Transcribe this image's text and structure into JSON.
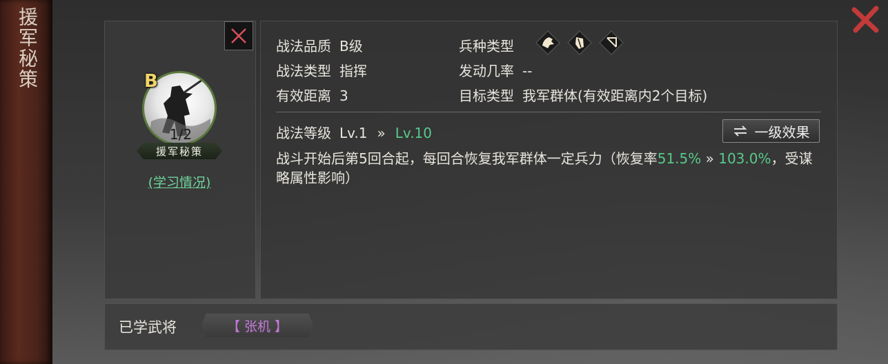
{
  "tactic": {
    "vertical_title": "援军秘策",
    "grade": "B",
    "learned_count": "1/2",
    "name_plate": "援军秘策",
    "learn_status_link": "(学习情况)"
  },
  "attributes": {
    "quality_label": "战法品质",
    "quality_value": "B级",
    "type_label": "战法类型",
    "type_value": "指挥",
    "range_label": "有效距离",
    "range_value": "3",
    "unit_label": "兵种类型",
    "unit_icons": [
      "cavalry-icon",
      "shield-icon",
      "bow-icon"
    ],
    "trigger_label": "发动几率",
    "trigger_value": "--",
    "target_label": "目标类型",
    "target_value": "我军群体(有效距离内2个目标)"
  },
  "level": {
    "label": "战法等级",
    "current": "Lv.1",
    "arrow": "»",
    "max": "Lv.10"
  },
  "effect_button": {
    "icon": "swap-icon",
    "label": "一级效果"
  },
  "description": {
    "prefix": "战斗开始后第5回合起，每回合恢复我军群体一定兵力（恢复率",
    "rate_min": "51.5%",
    "arrow": " » ",
    "rate_max": "103.0%",
    "suffix": "，受谋略属性影响）"
  },
  "learned_generals": {
    "label": "已学武将",
    "general": "【 张机 】"
  },
  "colors": {
    "accent_green": "#58c98a",
    "close_red": "#c23a3a",
    "general_purple": "#c27ad8",
    "grade_gold": "#f1d46a"
  }
}
